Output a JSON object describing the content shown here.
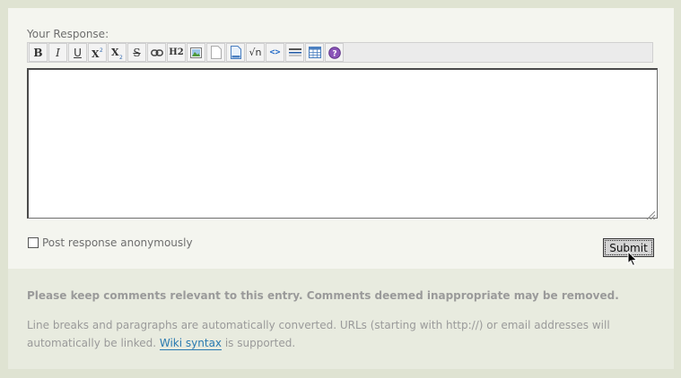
{
  "form": {
    "label": "Your Response:",
    "textarea_value": "",
    "anonymous_label": "Post response anonymously",
    "anonymous_checked": false,
    "submit_label": "Submit"
  },
  "toolbar": {
    "buttons": [
      {
        "name": "bold-button",
        "icon": "bold-icon",
        "glyph": "B"
      },
      {
        "name": "italic-button",
        "icon": "italic-icon",
        "glyph": "I"
      },
      {
        "name": "underline-button",
        "icon": "underline-icon",
        "glyph": "U"
      },
      {
        "name": "superscript-button",
        "icon": "superscript-icon",
        "glyph": "X2"
      },
      {
        "name": "subscript-button",
        "icon": "subscript-icon",
        "glyph": "X2"
      },
      {
        "name": "strikethrough-button",
        "icon": "strikethrough-icon",
        "glyph": "S"
      },
      {
        "name": "link-button",
        "icon": "link-icon"
      },
      {
        "name": "heading-button",
        "icon": "heading-icon",
        "glyph": "H2"
      },
      {
        "name": "image-button",
        "icon": "image-icon"
      },
      {
        "name": "page-button",
        "icon": "page-icon"
      },
      {
        "name": "document-button",
        "icon": "document-icon"
      },
      {
        "name": "math-button",
        "icon": "square-root-icon",
        "glyph": "√n"
      },
      {
        "name": "code-button",
        "icon": "code-icon",
        "glyph": "<>"
      },
      {
        "name": "horizontal-rule-button",
        "icon": "horizontal-rule-icon"
      },
      {
        "name": "table-button",
        "icon": "table-icon"
      },
      {
        "name": "help-button",
        "icon": "help-icon",
        "glyph": "?"
      }
    ]
  },
  "notes": {
    "warning": "Please keep comments relevant to this entry. Comments deemed inappropriate may be removed.",
    "info_before": "Line breaks and paragraphs are automatically converted. URLs (starting with http://) or email addresses will automatically be linked.",
    "wiki_link": "Wiki syntax",
    "info_after": " is supported."
  },
  "colors": {
    "background": "#dfe3d2",
    "panel": "#f4f5ef",
    "notes_panel": "#e8ebdf",
    "text_muted": "#9a9a9a",
    "link": "#2a7ab0"
  }
}
